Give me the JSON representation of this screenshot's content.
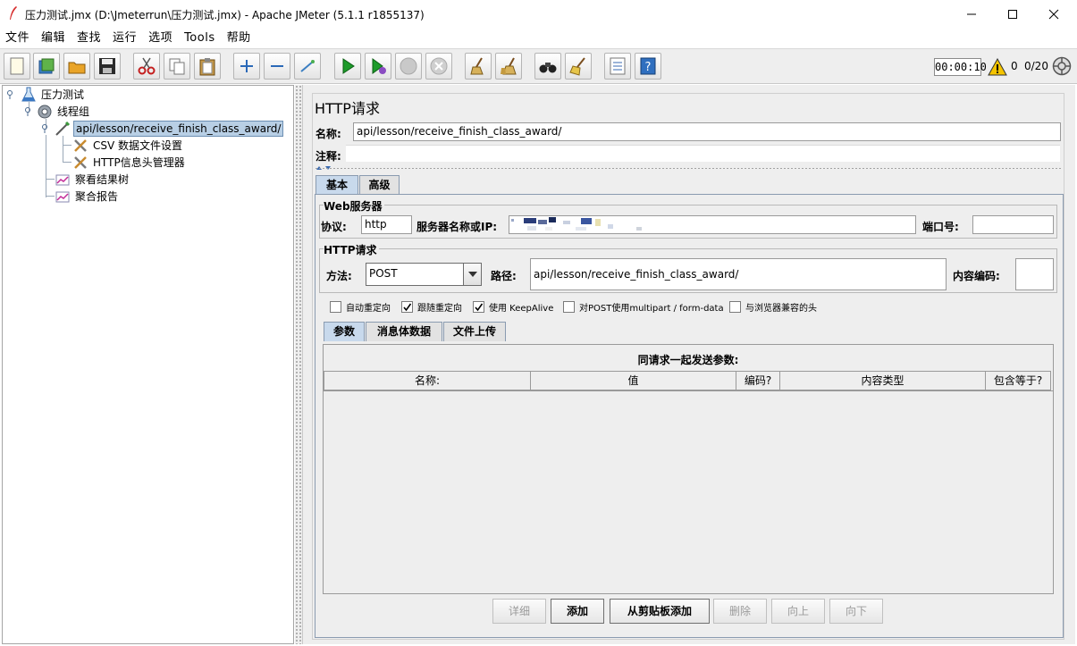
{
  "window": {
    "title": "压力测试.jmx (D:\\Jmeterrun\\压力测试.jmx) - Apache JMeter (5.1.1 r1855137)"
  },
  "menu": [
    {
      "label": "文件"
    },
    {
      "label": "编辑"
    },
    {
      "label": "查找"
    },
    {
      "label": "运行"
    },
    {
      "label": "选项"
    },
    {
      "label": "Tools"
    },
    {
      "label": "帮助"
    }
  ],
  "status": {
    "elapsed": "00:00:10",
    "warnings": "0",
    "threads": "0/20"
  },
  "tree": [
    {
      "label": "压力测试",
      "icon": "beaker-icon"
    },
    {
      "label": "线程组",
      "icon": "gear-icon"
    },
    {
      "label": "api/lesson/receive_finish_class_award/",
      "icon": "pipette-icon",
      "selected": true
    },
    {
      "label": "CSV 数据文件设置",
      "icon": "tools-icon"
    },
    {
      "label": "HTTP信息头管理器",
      "icon": "tools-icon"
    },
    {
      "label": "察看结果树",
      "icon": "chart-icon"
    },
    {
      "label": "聚合报告",
      "icon": "chart-icon"
    }
  ],
  "panel": {
    "title": "HTTP请求",
    "name_label": "名称:",
    "name_value": "api/lesson/receive_finish_class_award/",
    "comment_label": "注释:",
    "tabs": [
      {
        "label": "基本"
      },
      {
        "label": "高级"
      }
    ],
    "web_server": {
      "title": "Web服务器",
      "protocol_label": "协议:",
      "protocol_value": "http",
      "server_label": "服务器名称或IP:",
      "port_label": "端口号:"
    },
    "http_request": {
      "title": "HTTP请求",
      "method_label": "方法:",
      "method_value": "POST",
      "path_label": "路径:",
      "path_value": "api/lesson/receive_finish_class_award/",
      "encoding_label": "内容编码:"
    },
    "checkboxes": [
      {
        "label": "自动重定向",
        "checked": false
      },
      {
        "label": "跟随重定向",
        "checked": true
      },
      {
        "label": "使用 KeepAlive",
        "checked": true
      },
      {
        "label": "对POST使用multipart / form-data",
        "checked": false
      },
      {
        "label": "与浏览器兼容的头",
        "checked": false
      }
    ],
    "sub_tabs": [
      {
        "label": "参数"
      },
      {
        "label": "消息体数据"
      },
      {
        "label": "文件上传"
      }
    ],
    "params_caption": "同请求一起发送参数:",
    "columns": [
      "名称:",
      "值",
      "编码?",
      "内容类型",
      "包含等于?"
    ],
    "buttons": [
      {
        "label": "详细",
        "enabled": false
      },
      {
        "label": "添加",
        "enabled": true
      },
      {
        "label": "从剪贴板添加",
        "enabled": true
      },
      {
        "label": "删除",
        "enabled": false
      },
      {
        "label": "向上",
        "enabled": false
      },
      {
        "label": "向下",
        "enabled": false
      }
    ]
  },
  "colors": {
    "selection": "#b8cfe5",
    "active_tab": "#c8d9ec",
    "panel_bg": "#eeeeee",
    "run_green": "#1d9b2a",
    "warning_yellow": "#f5c400"
  }
}
